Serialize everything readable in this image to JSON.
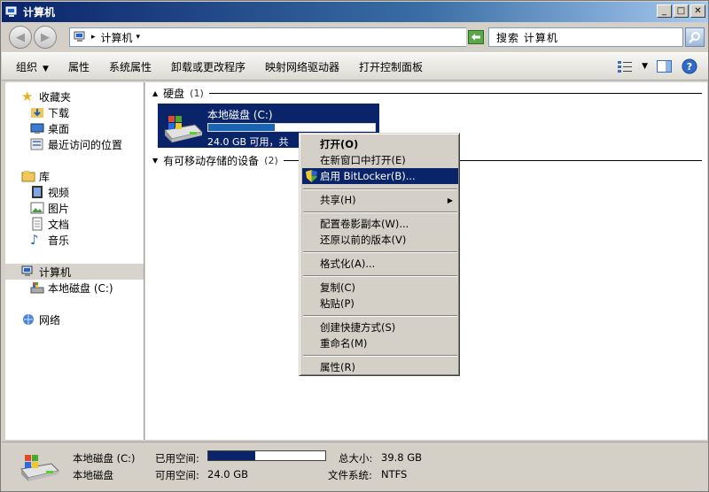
{
  "window": {
    "title": "计算机"
  },
  "address": {
    "crumb": "计算机"
  },
  "search": {
    "placeholder": "搜索 计算机"
  },
  "toolbar": {
    "items": [
      "组织",
      "属性",
      "系统属性",
      "卸载或更改程序",
      "映射网络驱动器",
      "打开控制面板"
    ]
  },
  "nav": {
    "favorites": "收藏夹",
    "downloads": "下载",
    "desktop": "桌面",
    "recent": "最近访问的位置",
    "libraries": "库",
    "videos": "视频",
    "pictures": "图片",
    "documents": "文档",
    "music": "音乐",
    "computer": "计算机",
    "local_disk": "本地磁盘 (C:)",
    "network": "网络"
  },
  "content": {
    "group_hdd": "硬盘",
    "group_hdd_count": "(1)",
    "group_removable": "有可移动存储的设备",
    "group_removable_count": "(2)",
    "drive_name": "本地磁盘 (C:)",
    "drive_free": "24.0 GB 可用，共",
    "drive_used_fraction": 0.4
  },
  "context_menu": {
    "open": "打开(O)",
    "open_new_window": "在新窗口中打开(E)",
    "bitlocker": "启用 BitLocker(B)...",
    "share": "共享(H)",
    "shadow_copy": "配置卷影副本(W)...",
    "restore": "还原以前的版本(V)",
    "format": "格式化(A)...",
    "copy": "复制(C)",
    "paste": "粘贴(P)",
    "shortcut": "创建快捷方式(S)",
    "rename": "重命名(M)",
    "properties": "属性(R)"
  },
  "details": {
    "name": "本地磁盘 (C:)",
    "type": "本地磁盘",
    "used_label": "已用空间:",
    "free_label": "可用空间:",
    "free_value": "24.0 GB",
    "total_label": "总大小:",
    "total_value": "39.8 GB",
    "fs_label": "文件系统:",
    "fs_value": "NTFS",
    "used_fraction": 0.4
  },
  "colors": {
    "selection": "#0a246a",
    "face": "#d4d0c8"
  }
}
